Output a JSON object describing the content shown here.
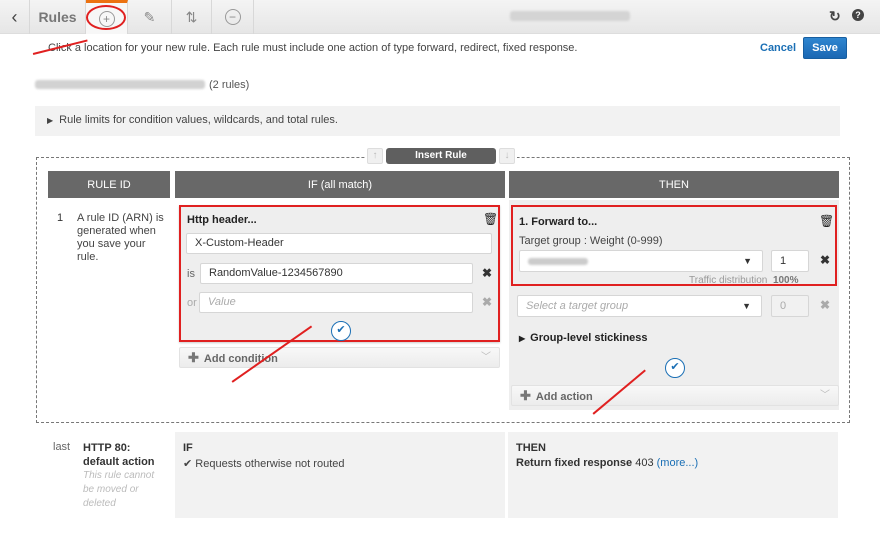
{
  "toolbar": {
    "back_icon": "‹",
    "title": "Rules",
    "add_icon": "+",
    "edit_icon": "✎",
    "reorder_icon": "⇅",
    "remove_icon": "−",
    "refresh_icon": "↻",
    "help_icon": "?",
    "load_balancer_label": "[blurred]"
  },
  "header": {
    "instruction": "Click a location for your new rule. Each rule must include one action of type forward, redirect, fixed response.",
    "cancel_label": "Cancel",
    "save_label": "Save",
    "listener_name": "[blurred]",
    "rule_count": "(2 rules)",
    "limits_text": "Rule limits for condition values, wildcards, and total rules."
  },
  "insert": {
    "label": "Insert Rule",
    "up_icon": "↑",
    "down_icon": "↓"
  },
  "columns": {
    "rule_id": "RULE ID",
    "if": "IF (all match)",
    "then": "THEN"
  },
  "rule1": {
    "number": "1",
    "description": "A rule ID (ARN) is generated when you save your rule.",
    "condition": {
      "title": "Http header...",
      "header_name": "X-Custom-Header",
      "is_label": "is",
      "value": "RandomValue-1234567890",
      "or_label": "or",
      "value_placeholder": "Value"
    },
    "add_condition_label": "Add condition",
    "action": {
      "title": "1. Forward to...",
      "target_label": "Target group : Weight (0-999)",
      "target_group": "[blurred]",
      "weight": "1",
      "traffic_label": "Traffic distribution",
      "traffic_value": "100%",
      "second_target_placeholder": "Select a target group",
      "second_weight": "0",
      "stickiness_label": "Group-level stickiness"
    },
    "add_action_label": "Add action"
  },
  "default_rule": {
    "number": "last",
    "title": "HTTP 80: default action",
    "note": "This rule cannot be moved or deleted",
    "if_title": "IF",
    "if_text": "Requests otherwise not routed",
    "then_title": "THEN",
    "then_action": "Return fixed response",
    "then_code": "403",
    "more_link": "(more...)"
  }
}
